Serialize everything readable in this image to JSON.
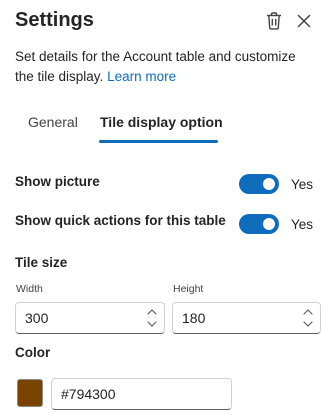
{
  "header": {
    "title": "Settings",
    "delete_icon": "trash-icon",
    "close_icon": "close-icon"
  },
  "description": {
    "text": "Set details for the Account table and customize the tile display.",
    "link": "Learn more"
  },
  "tabs": [
    {
      "label": "General",
      "selected": false
    },
    {
      "label": "Tile display option",
      "selected": true
    }
  ],
  "options": {
    "show_picture": {
      "label": "Show picture",
      "value": "Yes",
      "on": true
    },
    "show_quick_actions": {
      "label": "Show quick actions for this table",
      "value": "Yes",
      "on": true
    }
  },
  "tile_size": {
    "title": "Tile size",
    "width": {
      "label": "Width",
      "value": "300"
    },
    "height": {
      "label": "Height",
      "value": "180"
    }
  },
  "color": {
    "title": "Color",
    "value": "#794300",
    "swatch": "#794300"
  },
  "accent": "#0f6cbd"
}
